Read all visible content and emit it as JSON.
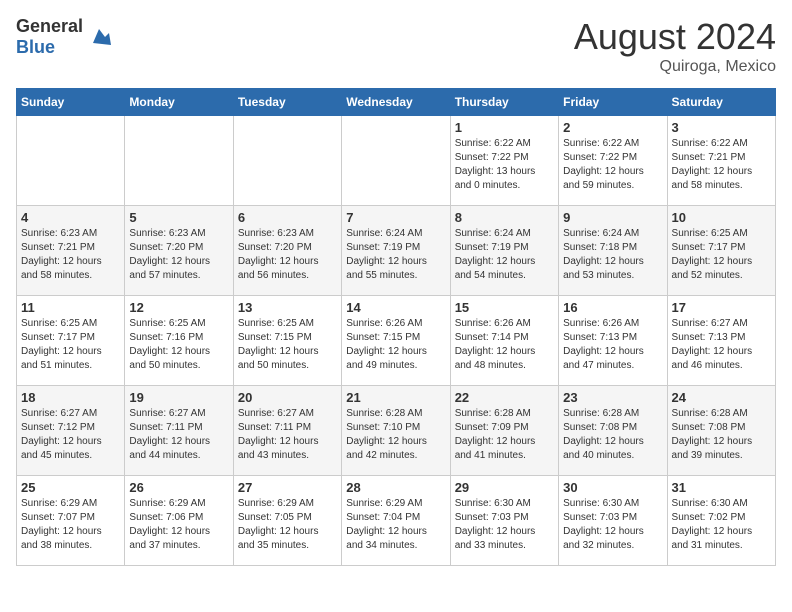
{
  "header": {
    "logo_general": "General",
    "logo_blue": "Blue",
    "month_year": "August 2024",
    "location": "Quiroga, Mexico"
  },
  "days_of_week": [
    "Sunday",
    "Monday",
    "Tuesday",
    "Wednesday",
    "Thursday",
    "Friday",
    "Saturday"
  ],
  "weeks": [
    [
      {
        "day": "",
        "info": ""
      },
      {
        "day": "",
        "info": ""
      },
      {
        "day": "",
        "info": ""
      },
      {
        "day": "",
        "info": ""
      },
      {
        "day": "1",
        "info": "Sunrise: 6:22 AM\nSunset: 7:22 PM\nDaylight: 13 hours and 0 minutes."
      },
      {
        "day": "2",
        "info": "Sunrise: 6:22 AM\nSunset: 7:22 PM\nDaylight: 12 hours and 59 minutes."
      },
      {
        "day": "3",
        "info": "Sunrise: 6:22 AM\nSunset: 7:21 PM\nDaylight: 12 hours and 58 minutes."
      }
    ],
    [
      {
        "day": "4",
        "info": "Sunrise: 6:23 AM\nSunset: 7:21 PM\nDaylight: 12 hours and 58 minutes."
      },
      {
        "day": "5",
        "info": "Sunrise: 6:23 AM\nSunset: 7:20 PM\nDaylight: 12 hours and 57 minutes."
      },
      {
        "day": "6",
        "info": "Sunrise: 6:23 AM\nSunset: 7:20 PM\nDaylight: 12 hours and 56 minutes."
      },
      {
        "day": "7",
        "info": "Sunrise: 6:24 AM\nSunset: 7:19 PM\nDaylight: 12 hours and 55 minutes."
      },
      {
        "day": "8",
        "info": "Sunrise: 6:24 AM\nSunset: 7:19 PM\nDaylight: 12 hours and 54 minutes."
      },
      {
        "day": "9",
        "info": "Sunrise: 6:24 AM\nSunset: 7:18 PM\nDaylight: 12 hours and 53 minutes."
      },
      {
        "day": "10",
        "info": "Sunrise: 6:25 AM\nSunset: 7:17 PM\nDaylight: 12 hours and 52 minutes."
      }
    ],
    [
      {
        "day": "11",
        "info": "Sunrise: 6:25 AM\nSunset: 7:17 PM\nDaylight: 12 hours and 51 minutes."
      },
      {
        "day": "12",
        "info": "Sunrise: 6:25 AM\nSunset: 7:16 PM\nDaylight: 12 hours and 50 minutes."
      },
      {
        "day": "13",
        "info": "Sunrise: 6:25 AM\nSunset: 7:15 PM\nDaylight: 12 hours and 50 minutes."
      },
      {
        "day": "14",
        "info": "Sunrise: 6:26 AM\nSunset: 7:15 PM\nDaylight: 12 hours and 49 minutes."
      },
      {
        "day": "15",
        "info": "Sunrise: 6:26 AM\nSunset: 7:14 PM\nDaylight: 12 hours and 48 minutes."
      },
      {
        "day": "16",
        "info": "Sunrise: 6:26 AM\nSunset: 7:13 PM\nDaylight: 12 hours and 47 minutes."
      },
      {
        "day": "17",
        "info": "Sunrise: 6:27 AM\nSunset: 7:13 PM\nDaylight: 12 hours and 46 minutes."
      }
    ],
    [
      {
        "day": "18",
        "info": "Sunrise: 6:27 AM\nSunset: 7:12 PM\nDaylight: 12 hours and 45 minutes."
      },
      {
        "day": "19",
        "info": "Sunrise: 6:27 AM\nSunset: 7:11 PM\nDaylight: 12 hours and 44 minutes."
      },
      {
        "day": "20",
        "info": "Sunrise: 6:27 AM\nSunset: 7:11 PM\nDaylight: 12 hours and 43 minutes."
      },
      {
        "day": "21",
        "info": "Sunrise: 6:28 AM\nSunset: 7:10 PM\nDaylight: 12 hours and 42 minutes."
      },
      {
        "day": "22",
        "info": "Sunrise: 6:28 AM\nSunset: 7:09 PM\nDaylight: 12 hours and 41 minutes."
      },
      {
        "day": "23",
        "info": "Sunrise: 6:28 AM\nSunset: 7:08 PM\nDaylight: 12 hours and 40 minutes."
      },
      {
        "day": "24",
        "info": "Sunrise: 6:28 AM\nSunset: 7:08 PM\nDaylight: 12 hours and 39 minutes."
      }
    ],
    [
      {
        "day": "25",
        "info": "Sunrise: 6:29 AM\nSunset: 7:07 PM\nDaylight: 12 hours and 38 minutes."
      },
      {
        "day": "26",
        "info": "Sunrise: 6:29 AM\nSunset: 7:06 PM\nDaylight: 12 hours and 37 minutes."
      },
      {
        "day": "27",
        "info": "Sunrise: 6:29 AM\nSunset: 7:05 PM\nDaylight: 12 hours and 35 minutes."
      },
      {
        "day": "28",
        "info": "Sunrise: 6:29 AM\nSunset: 7:04 PM\nDaylight: 12 hours and 34 minutes."
      },
      {
        "day": "29",
        "info": "Sunrise: 6:30 AM\nSunset: 7:03 PM\nDaylight: 12 hours and 33 minutes."
      },
      {
        "day": "30",
        "info": "Sunrise: 6:30 AM\nSunset: 7:03 PM\nDaylight: 12 hours and 32 minutes."
      },
      {
        "day": "31",
        "info": "Sunrise: 6:30 AM\nSunset: 7:02 PM\nDaylight: 12 hours and 31 minutes."
      }
    ]
  ]
}
